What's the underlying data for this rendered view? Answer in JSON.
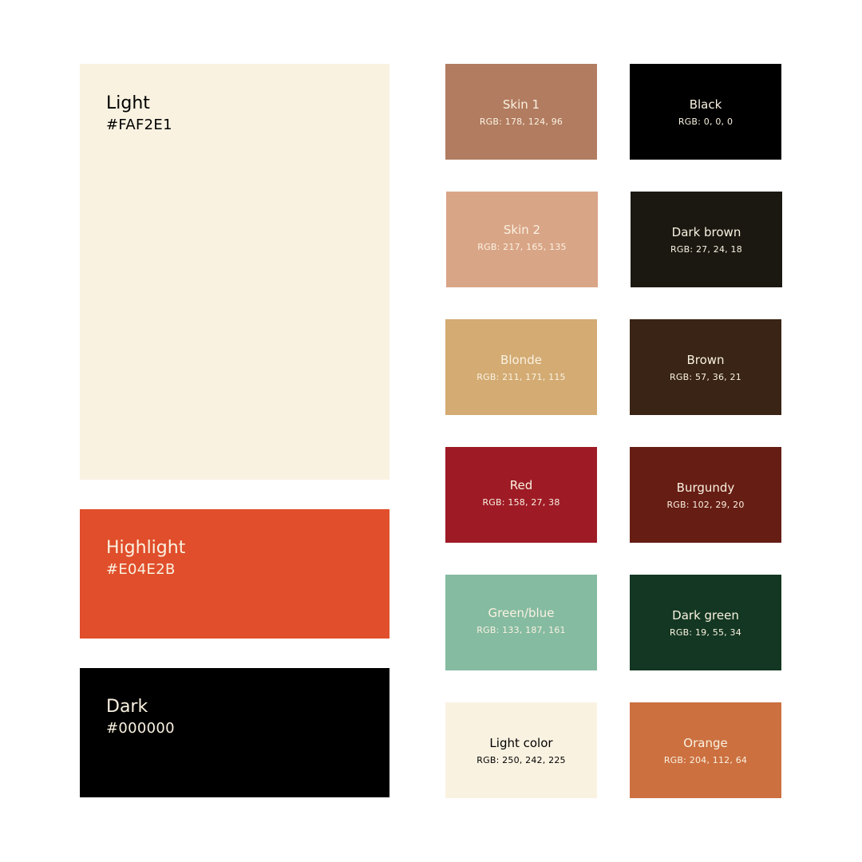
{
  "primary": {
    "light": {
      "name": "Light",
      "hex": "#FAF2E1",
      "color": "#FAF2E1",
      "text_color": "#000000"
    },
    "highlight": {
      "name": "Highlight",
      "hex": "#E04E2B",
      "color": "#E04E2B",
      "text_color": "#FAF2E1"
    },
    "dark": {
      "name": "Dark",
      "hex": "#000000",
      "color": "#000000",
      "text_color": "#FAF2E1"
    }
  },
  "swatches": [
    {
      "name": "Skin 1",
      "rgb": "RGB: 178, 124, 96",
      "color": "#B27C60",
      "text_color": "#FAF2E1"
    },
    {
      "name": "Black",
      "rgb": "RGB: 0, 0, 0",
      "color": "#000000",
      "text_color": "#FAF2E1"
    },
    {
      "name": "Skin 2",
      "rgb": "RGB: 217, 165, 135",
      "color": "#D9A587",
      "text_color": "#FAF2E1"
    },
    {
      "name": "Dark brown",
      "rgb": "RGB: 27, 24, 18",
      "color": "#1B1812",
      "text_color": "#FAF2E1"
    },
    {
      "name": "Blonde",
      "rgb": "RGB: 211, 171, 115",
      "color": "#D3AB73",
      "text_color": "#FAF2E1"
    },
    {
      "name": "Brown",
      "rgb": "RGB: 57, 36, 21",
      "color": "#392415",
      "text_color": "#FAF2E1"
    },
    {
      "name": "Red",
      "rgb": "RGB: 158, 27, 38",
      "color": "#9E1B26",
      "text_color": "#FAF2E1"
    },
    {
      "name": "Burgundy",
      "rgb": "RGB: 102, 29, 20",
      "color": "#661D14",
      "text_color": "#FAF2E1"
    },
    {
      "name": "Green/blue",
      "rgb": "RGB: 133, 187, 161",
      "color": "#85BBA1",
      "text_color": "#FAF2E1"
    },
    {
      "name": "Dark green",
      "rgb": "RGB: 19, 55, 34",
      "color": "#133722",
      "text_color": "#FAF2E1"
    },
    {
      "name": "Light color",
      "rgb": "RGB: 250, 242, 225",
      "color": "#FAF2E1",
      "text_color": "#000000"
    },
    {
      "name": "Orange",
      "rgb": "RGB: 204, 112, 64",
      "color": "#CC7040",
      "text_color": "#FAF2E1"
    }
  ]
}
